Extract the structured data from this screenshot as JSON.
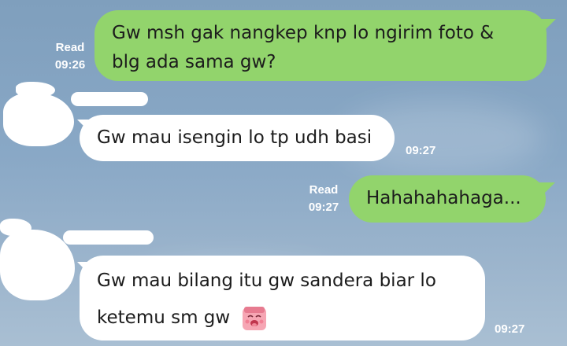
{
  "messages": [
    {
      "direction": "out",
      "lines": [
        "Gw msh gak nangkep knp lo ngirim foto &",
        "blg ada sama gw?"
      ],
      "status": "Read",
      "time": "09:26"
    },
    {
      "direction": "in",
      "text": "Gw mau isengin lo tp udh basi",
      "time": "09:27"
    },
    {
      "direction": "out",
      "text": "Hahahahahaga...",
      "status": "Read",
      "time": "09:27"
    },
    {
      "direction": "in",
      "lines": [
        "Gw mau bilang itu gw sandera biar lo",
        "ketemu sm gw"
      ],
      "sticker_icon": "blushing-face-sticker-icon",
      "time": "09:27"
    }
  ],
  "colors": {
    "outgoing_bubble": "#92d46c",
    "incoming_bubble": "#ffffff",
    "background": "#89a8c6"
  }
}
